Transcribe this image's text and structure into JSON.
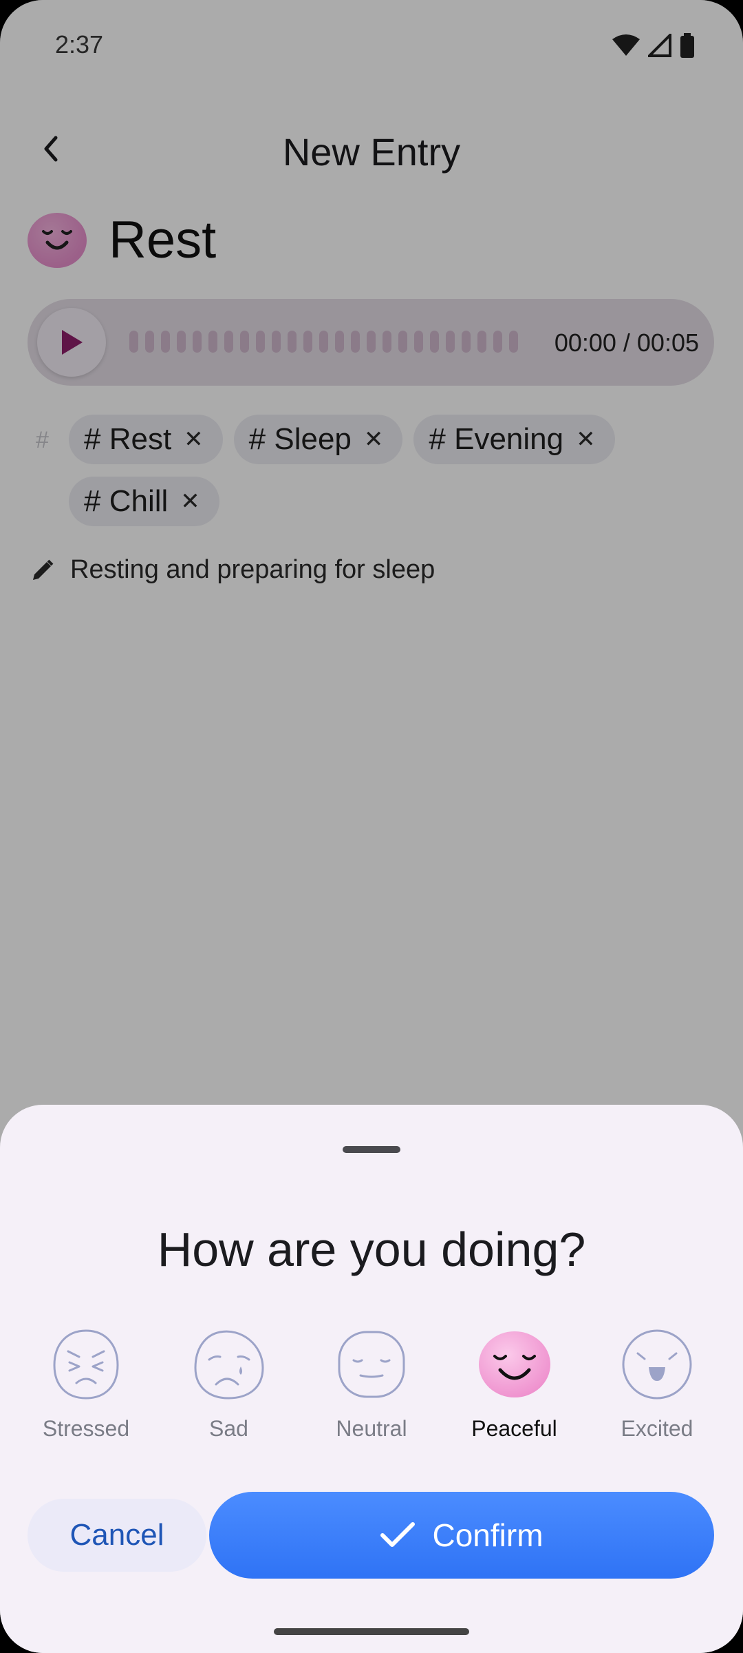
{
  "status_bar": {
    "time": "2:37"
  },
  "header": {
    "title": "New Entry"
  },
  "entry": {
    "mood_title": "Rest",
    "audio": {
      "time": "00:00 / 00:05"
    },
    "tags": [
      {
        "label": "# Rest"
      },
      {
        "label": "# Sleep"
      },
      {
        "label": "# Evening"
      },
      {
        "label": "# Chill"
      }
    ],
    "note": "Resting and preparing for sleep"
  },
  "sheet": {
    "title": "How are you doing?",
    "moods": [
      {
        "label": "Stressed",
        "icon": "stressed-face-icon",
        "selected": false
      },
      {
        "label": "Sad",
        "icon": "sad-face-icon",
        "selected": false
      },
      {
        "label": "Neutral",
        "icon": "neutral-face-icon",
        "selected": false
      },
      {
        "label": "Peaceful",
        "icon": "peaceful-face-icon",
        "selected": true
      },
      {
        "label": "Excited",
        "icon": "excited-face-icon",
        "selected": false
      }
    ],
    "cancel_label": "Cancel",
    "confirm_label": "Confirm"
  },
  "colors": {
    "accent": "#2f73f5",
    "peaceful": "#f0a3d8",
    "sheet_bg": "#f5f0f8"
  }
}
